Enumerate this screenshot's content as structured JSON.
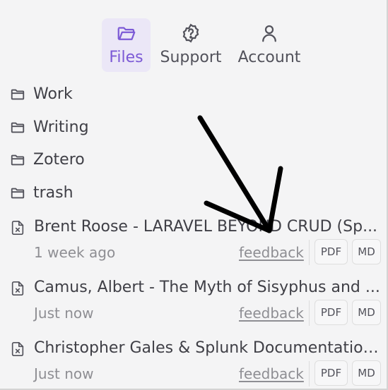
{
  "tabs": [
    {
      "label": "Files",
      "icon": "folder-open-icon",
      "active": true
    },
    {
      "label": "Support",
      "icon": "help-circle-icon",
      "active": false
    },
    {
      "label": "Account",
      "icon": "user-icon",
      "active": false
    }
  ],
  "folders": [
    {
      "name": "Work",
      "icon": "folder-icon"
    },
    {
      "name": "Writing",
      "icon": "folder-icon"
    },
    {
      "name": "Zotero",
      "icon": "folder-icon"
    },
    {
      "name": "trash",
      "icon": "folder-icon"
    }
  ],
  "files": [
    {
      "name": "Brent Roose - LARAVEL BEYOND CRUD (Sp...",
      "time": "1 week ago",
      "feedback": "feedback",
      "pdf": "PDF",
      "md": "MD",
      "icon": "file-x-icon"
    },
    {
      "name": "Camus, Albert - The Myth of Sisyphus and ...",
      "time": "Just now",
      "feedback": "feedback",
      "pdf": "PDF",
      "md": "MD",
      "icon": "file-x-icon"
    },
    {
      "name": "Christopher Gales & Splunk Documentation ...",
      "time": "Just now",
      "feedback": "feedback",
      "pdf": "PDF",
      "md": "MD",
      "icon": "file-x-icon"
    }
  ],
  "colors": {
    "accent": "#7c5ad6",
    "accent_bg": "#ebe7f7",
    "panel_bg": "#f4f4f5",
    "text": "#3f3f46",
    "muted": "#8e8e93",
    "annotation_arrow": "#000000"
  }
}
